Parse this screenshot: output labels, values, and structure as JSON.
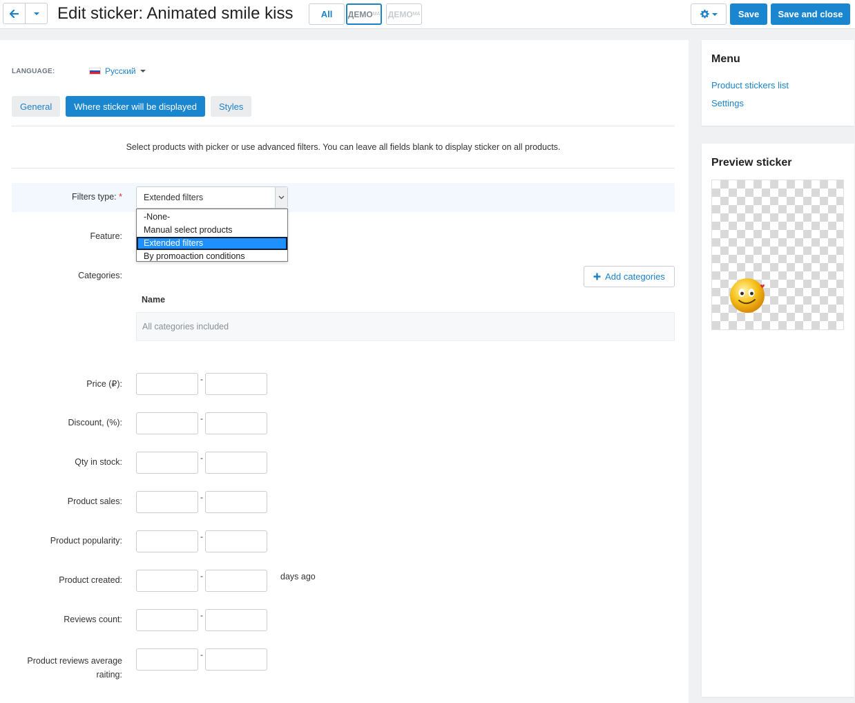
{
  "header": {
    "title": "Edit sticker: Animated smile kiss",
    "store_all_label": "All",
    "store_logo_text": "ДЕМО",
    "store_logo_suffix": "МА",
    "save_label": "Save",
    "save_close_label": "Save and close"
  },
  "language": {
    "label": "LANGUAGE:",
    "value": "Русский"
  },
  "tabs": [
    {
      "label": "General"
    },
    {
      "label": "Where sticker will be displayed"
    },
    {
      "label": "Styles"
    }
  ],
  "notice": "Select products with picker or use advanced filters. You can leave all fields blank to display sticker on all products.",
  "filters": {
    "label": "Filters type:",
    "required_mark": "*",
    "value": "Extended filters",
    "options": [
      "-None-",
      "Manual select products",
      "Extended filters",
      "By promoaction conditions"
    ]
  },
  "feature_label": "Feature:",
  "categories": {
    "label": "Categories:",
    "add_label": "Add categories",
    "column_name": "Name",
    "empty_text": "All categories included"
  },
  "ranges": [
    {
      "label": "Price (₽):"
    },
    {
      "label": "Discount, (%):"
    },
    {
      "label": "Qty in stock:"
    },
    {
      "label": "Product sales:"
    },
    {
      "label": "Product popularity:"
    },
    {
      "label": "Product created:",
      "suffix": "days ago"
    },
    {
      "label": "Reviews count:"
    },
    {
      "label": "Product reviews average raiting:"
    }
  ],
  "range_separator": "-",
  "sidebar": {
    "menu_title": "Menu",
    "links": [
      {
        "label": "Product stickers list"
      },
      {
        "label": "Settings"
      }
    ],
    "preview_title": "Preview sticker"
  },
  "colors": {
    "accent": "#1a86d0",
    "selected_option": "#1e90ff",
    "filters_row_bg": "#f2f8fd",
    "required": "#e02b2b"
  }
}
